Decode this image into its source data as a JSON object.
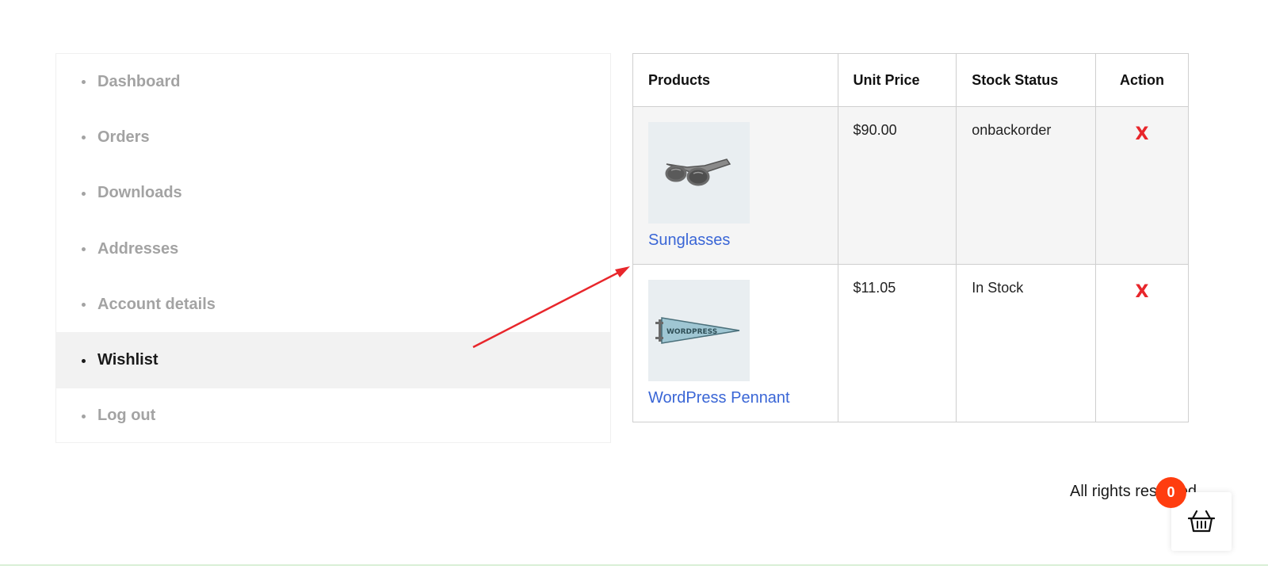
{
  "account_nav": {
    "items": [
      {
        "label": "Dashboard",
        "active": false
      },
      {
        "label": "Orders",
        "active": false
      },
      {
        "label": "Downloads",
        "active": false
      },
      {
        "label": "Addresses",
        "active": false
      },
      {
        "label": "Account details",
        "active": false
      },
      {
        "label": "Wishlist",
        "active": true
      },
      {
        "label": "Log out",
        "active": false
      }
    ]
  },
  "wishlist": {
    "headers": {
      "products": "Products",
      "unit_price": "Unit Price",
      "stock_status": "Stock Status",
      "action": "Action"
    },
    "rows": [
      {
        "name": "Sunglasses",
        "price": "$90.00",
        "stock": "onbackorder",
        "remove": "X",
        "icon": "sunglasses-image"
      },
      {
        "name": "WordPress Pennant",
        "price": "$11.05",
        "stock": "In Stock",
        "remove": "X",
        "icon": "pennant-image",
        "pennant_text": "WORDPRESS"
      }
    ]
  },
  "footer": {
    "text": "All rights reserved"
  },
  "cart": {
    "count": "0",
    "icon": "basket-icon"
  },
  "colors": {
    "link": "#3a66d6",
    "remove": "#e8262b",
    "badge": "#ff3d0f",
    "arrow": "#e8262b"
  }
}
